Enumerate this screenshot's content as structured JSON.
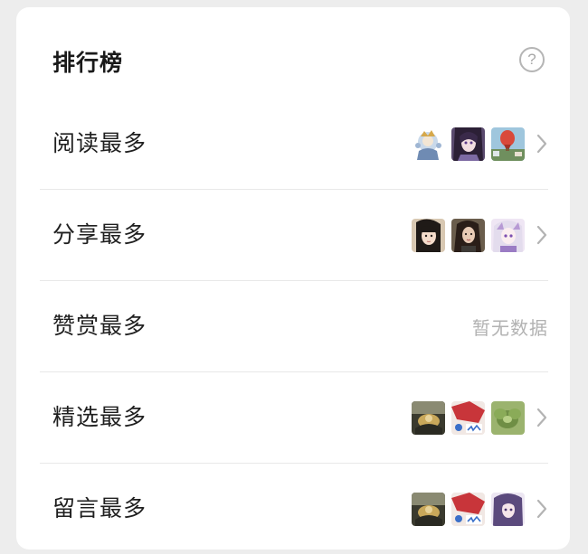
{
  "header": {
    "title": "排行榜",
    "help_icon": "question-circle-icon",
    "help_glyph": "?"
  },
  "rows": [
    {
      "label": "阅读最多",
      "status": "",
      "avatars": [
        "avatar-illustration-character",
        "avatar-anime-girl-purple",
        "avatar-hot-air-balloon"
      ],
      "chevron": "chevron-right-icon"
    },
    {
      "label": "分享最多",
      "status": "",
      "avatars": [
        "avatar-photo-girl",
        "avatar-photo-woman",
        "avatar-anime-white-hair"
      ],
      "chevron": "chevron-right-icon"
    },
    {
      "label": "赞赏最多",
      "status": "暂无数据",
      "avatars": [],
      "chevron": ""
    },
    {
      "label": "精选最多",
      "status": "",
      "avatars": [
        "avatar-dark-landscape",
        "avatar-red-poster",
        "avatar-succulent-plant"
      ],
      "chevron": "chevron-right-icon"
    },
    {
      "label": "留言最多",
      "status": "",
      "avatars": [
        "avatar-dark-landscape",
        "avatar-red-poster",
        "avatar-anime-purple-hair"
      ],
      "chevron": "chevron-right-icon"
    }
  ],
  "colors": {
    "background": "#ededed",
    "card": "#ffffff",
    "text": "#1f1f1f",
    "muted": "#b2b2b2",
    "divider": "#e8e8e8"
  }
}
